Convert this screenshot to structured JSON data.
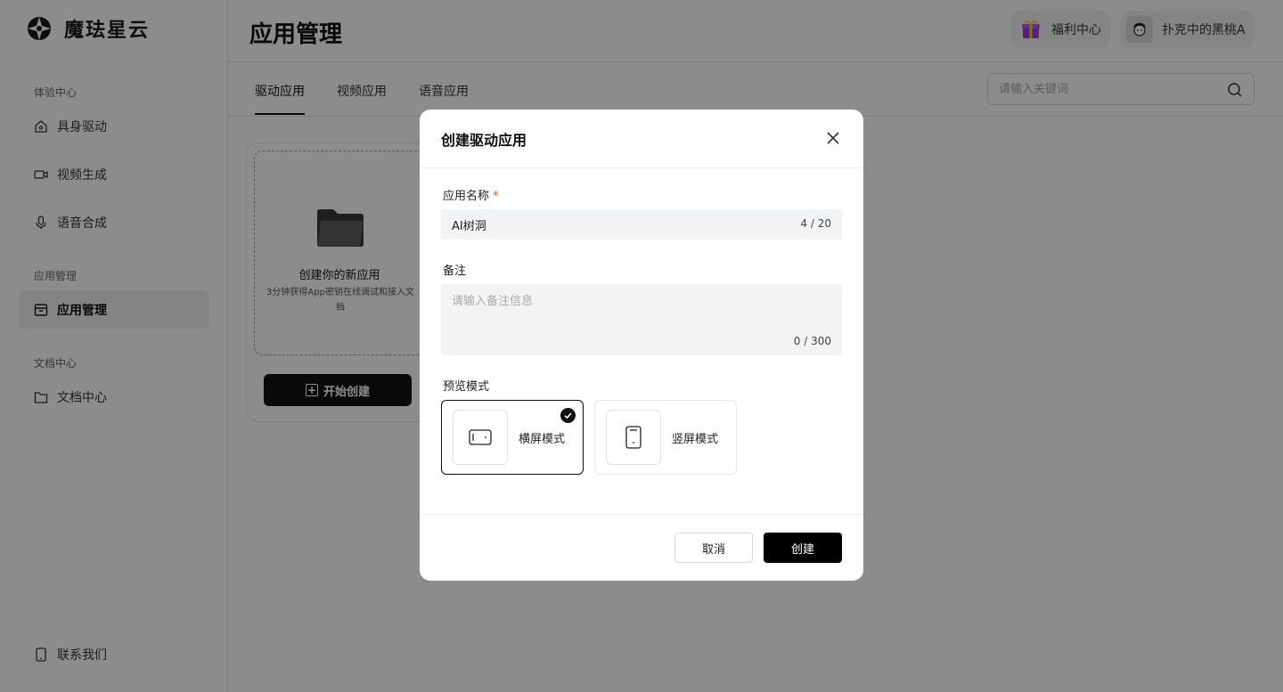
{
  "app": {
    "brand_name": "魔珐星云"
  },
  "sidebar": {
    "sections": [
      {
        "title": "体验中心"
      },
      {
        "title": "应用管理"
      },
      {
        "title": "文档中心"
      }
    ],
    "items": [
      {
        "label": "具身驱动",
        "icon": "home-camera-icon"
      },
      {
        "label": "视频生成",
        "icon": "video-camera-icon"
      },
      {
        "label": "语音合成",
        "icon": "microphone-icon"
      },
      {
        "label": "应用管理",
        "icon": "archive-box-icon",
        "active": true
      },
      {
        "label": "文档中心",
        "icon": "folder-icon"
      }
    ],
    "contact_label": "联系我们"
  },
  "header": {
    "title": "应用管理",
    "welfare_label": "福利中心",
    "username": "扑克中的黑桃A"
  },
  "tabs": [
    {
      "label": "驱动应用",
      "active": true
    },
    {
      "label": "视频应用"
    },
    {
      "label": "语音应用"
    }
  ],
  "search": {
    "placeholder": "请输入关键词",
    "value": ""
  },
  "card": {
    "title": "创建你的新应用",
    "desc": "3分钟获得App密钥在线调试和接入文档",
    "button_label": "开始创建"
  },
  "modal": {
    "title": "创建驱动应用",
    "name_label": "应用名称",
    "required_mark": "*",
    "name_value": "AI树洞",
    "name_counter": "4 / 20",
    "note_label": "备注",
    "note_placeholder": "请输入备注信息",
    "note_value": "",
    "note_counter": "0 / 300",
    "preview_label": "预览模式",
    "modes": [
      {
        "label": "横屏模式",
        "selected": true
      },
      {
        "label": "竖屏模式",
        "selected": false
      }
    ],
    "cancel_label": "取消",
    "create_label": "创建"
  },
  "colors": {
    "accent": "#111111",
    "required": "#e5532c",
    "overlay": "rgba(0,0,0,0.45)"
  }
}
